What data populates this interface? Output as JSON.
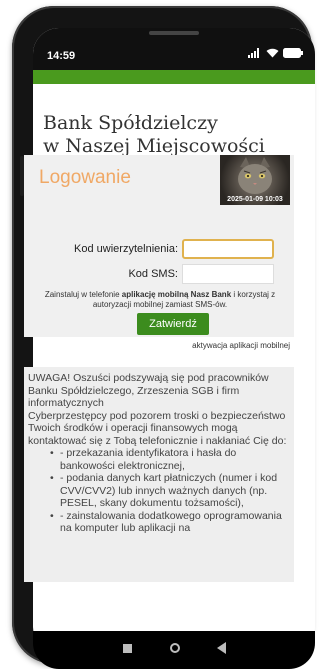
{
  "status": {
    "time": "14:59",
    "battery": "100"
  },
  "bank": {
    "name_line1": "Bank Spółdzielczy",
    "name_line2": "w Naszej Miejscowości"
  },
  "login": {
    "heading": "Logowanie",
    "photo_timestamp": "2025-01-09 10:03",
    "auth_label": "Kod uwierzytelnienia:",
    "auth_value": "",
    "sms_label": "Kod SMS:",
    "sms_value": "",
    "note_part1": "Zainstaluj w telefonie ",
    "note_bold": "aplikację mobilną Nasz Bank",
    "note_part2": " i korzystaj z autoryzacji mobilnej zamiast SMS-ów.",
    "submit_label": "Zatwierdź",
    "activation_link": "aktywacja aplikacji mobilnej"
  },
  "warning": {
    "intro": "UWAGA! Oszuści podszywają się pod pracowników Banku Spółdzielczego, Zrzeszenia SGB i firm informatycznych",
    "body": "Cyberprzestępcy pod pozorem troski o bezpieczeństwo Twoich środków i operacji finansowych mogą kontaktować się z Tobą telefonicznie i nakłaniać Cię do:",
    "items": [
      "- przekazania identyfikatora i hasła do bankowości elektronicznej,",
      "- podania danych kart płatniczych (numer i kod CVV/CVV2) lub innych ważnych danych (np. PESEL, skany dokumentu tożsamości),",
      "- zainstalowania dodatkowego oprogramowania na komputer lub aplikacji na"
    ]
  },
  "colors": {
    "accent_green": "#4a9a1e",
    "heading_orange": "#f0a865",
    "button_green": "#3c8c1e"
  }
}
